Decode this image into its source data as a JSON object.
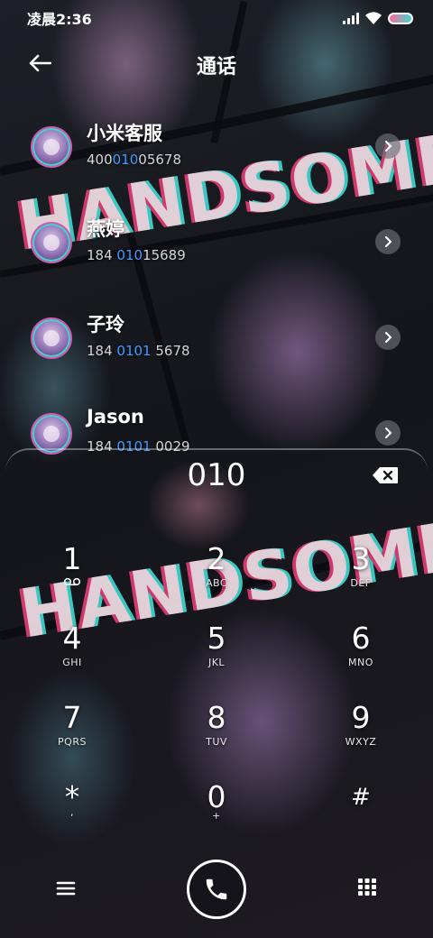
{
  "status_bar": {
    "time": "凌晨2:36"
  },
  "header": {
    "title": "通话"
  },
  "contacts": [
    {
      "name": "小米客服",
      "number_pre": "400",
      "number_match": "010",
      "number_post": "05678"
    },
    {
      "name": "燕婷",
      "number_pre": "184 ",
      "number_match": "010",
      "number_post": "15689"
    },
    {
      "name": "子玲",
      "number_pre": "184 ",
      "number_match": "0101",
      "number_post": " 5678"
    },
    {
      "name": "Jason",
      "number_pre": "184 ",
      "number_match": "0101",
      "number_post": " 0029"
    }
  ],
  "dialer": {
    "input": "010"
  },
  "keypad": [
    {
      "digit": "1",
      "sub": ""
    },
    {
      "digit": "2",
      "sub": "ABC"
    },
    {
      "digit": "3",
      "sub": "DEF"
    },
    {
      "digit": "4",
      "sub": "GHI"
    },
    {
      "digit": "5",
      "sub": "JKL"
    },
    {
      "digit": "6",
      "sub": "MNO"
    },
    {
      "digit": "7",
      "sub": "PQRS"
    },
    {
      "digit": "8",
      "sub": "TUV"
    },
    {
      "digit": "9",
      "sub": "WXYZ"
    },
    {
      "digit": "*",
      "sub": ","
    },
    {
      "digit": "0",
      "sub": "+"
    },
    {
      "digit": "#",
      "sub": ""
    }
  ],
  "wallpaper": {
    "text_1": "HANDSOME",
    "text_2": "HANDSOME"
  },
  "colors": {
    "match_highlight": "#3f9bff",
    "accent_pink": "#e03c73",
    "accent_cyan": "#3fd6cf"
  },
  "icons": {
    "back": "arrow-left-icon",
    "chevron": "chevron-right-icon",
    "backspace": "backspace-icon",
    "voicemail": "voicemail-icon",
    "menu": "menu-icon",
    "call": "phone-icon",
    "keypad": "dialpad-icon"
  }
}
